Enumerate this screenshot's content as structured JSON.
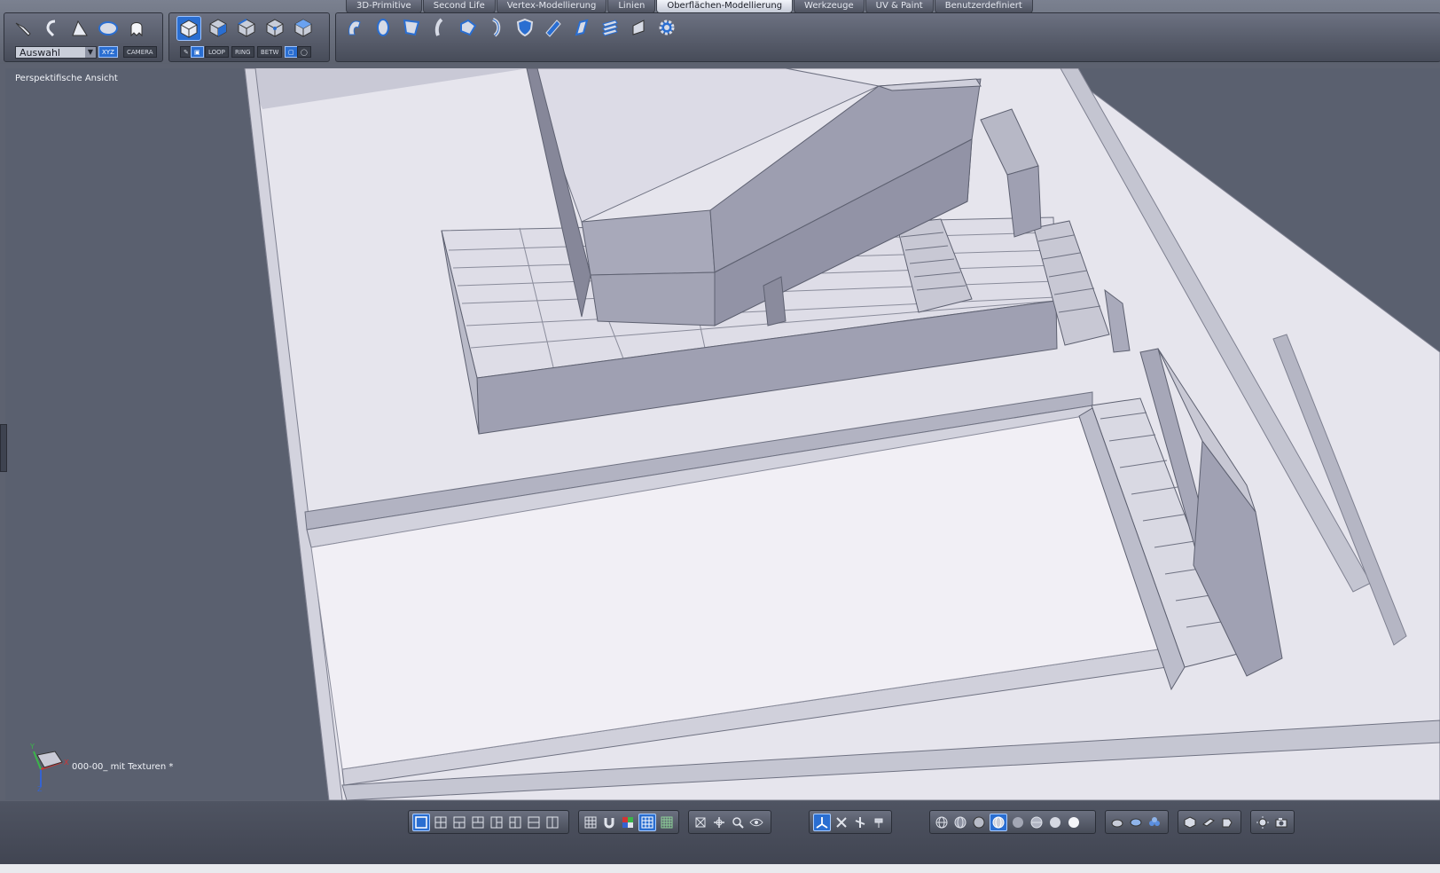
{
  "tabs": [
    {
      "label": "3D-Primitive"
    },
    {
      "label": "Second Life"
    },
    {
      "label": "Vertex-Modellierung"
    },
    {
      "label": "Linien"
    },
    {
      "label": "Oberflächen-Modellierung",
      "active": true
    },
    {
      "label": "Werkzeuge"
    },
    {
      "label": "UV & Paint"
    },
    {
      "label": "Benutzerdefiniert"
    }
  ],
  "toolbar": {
    "mode_select_value": "Auswahl",
    "xyz_label": "XYZ",
    "camera_label": "CAMERA",
    "loop_label": "LOOP",
    "ring_label": "RING",
    "betw_label": "BETW"
  },
  "viewport": {
    "view_label": "Perspektifische Ansicht",
    "scene_label": "000-00_ mit Texturen *",
    "axis_x": "X",
    "axis_y": "Y",
    "axis_z": "Z"
  },
  "colors": {
    "accent": "#2a6ed1",
    "viewport_bg": "#5a606f",
    "ground": "#e7e6ee",
    "model": "#8b8c9d"
  }
}
